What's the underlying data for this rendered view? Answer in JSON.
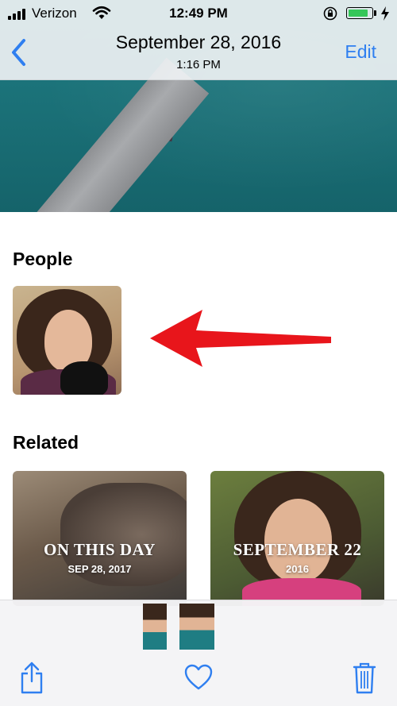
{
  "status_bar": {
    "carrier": "Verizon",
    "time": "12:49 PM"
  },
  "nav": {
    "title": "September 28, 2016",
    "subtitle": "1:16 PM",
    "edit_label": "Edit"
  },
  "people": {
    "title": "People"
  },
  "related": {
    "title": "Related",
    "cards": [
      {
        "title": "ON THIS DAY",
        "subtitle": "SEP 28, 2017"
      },
      {
        "title": "SEPTEMBER 22",
        "subtitle": "2016"
      }
    ]
  },
  "colors": {
    "accent": "#2f7ff0",
    "battery": "#35c759",
    "arrow": "#e8151b"
  },
  "icons": [
    "signal-icon",
    "wifi-icon",
    "orientation-lock-icon",
    "battery-icon",
    "charging-bolt-icon",
    "back-chevron-icon",
    "share-icon",
    "heart-icon",
    "trash-icon"
  ]
}
